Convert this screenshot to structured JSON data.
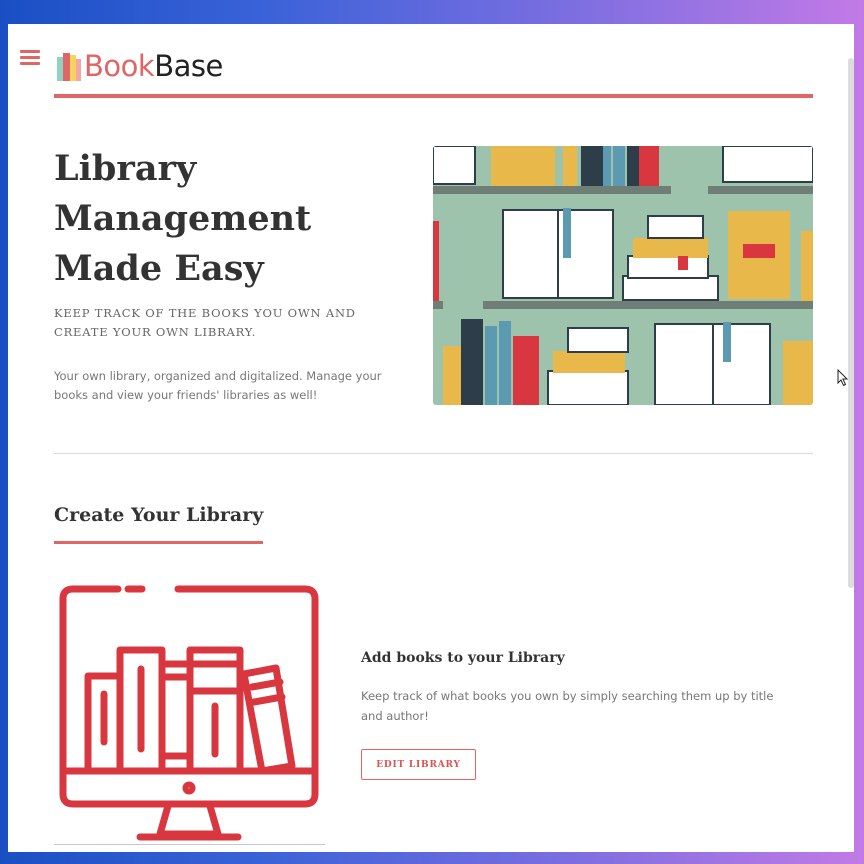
{
  "brand": {
    "name_part1": "Book",
    "name_part2": "Base"
  },
  "hero": {
    "title_lines": [
      "Library",
      "Management",
      "Made Easy"
    ],
    "subtitle": "KEEP TRACK OF THE BOOKS YOU OWN AND CREATE YOUR OWN LIBRARY.",
    "description": "Your own library, organized and digitalized. Manage your books and view your friends' libraries as well!"
  },
  "section": {
    "title": "Create Your Library"
  },
  "feature": {
    "title": "Add books to your Library",
    "description": "Keep track of what books you own by simply searching them up by title and author!",
    "button_label": "EDIT LIBRARY"
  },
  "icons": {
    "menu": "hamburger-menu-icon",
    "logo": "books-logo-icon",
    "hero_image": "bookshelf-illustration",
    "feature_image": "monitor-books-icon",
    "cursor": "mouse-pointer-icon"
  },
  "colors": {
    "accent": "#e06565",
    "text_dark": "#333333",
    "text_muted": "#777777"
  }
}
